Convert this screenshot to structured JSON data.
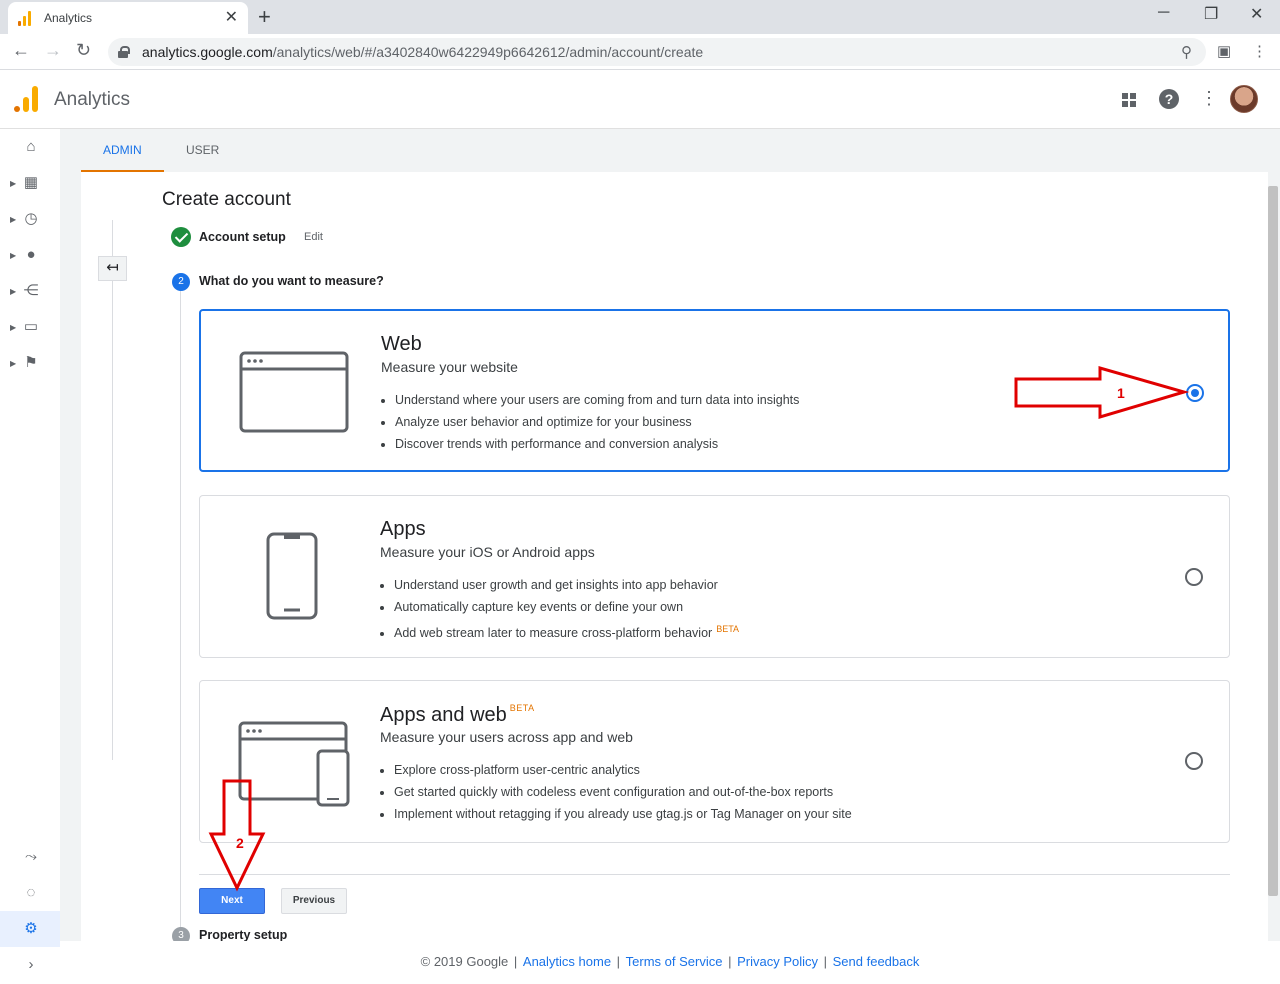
{
  "browser": {
    "tab_title": "Analytics",
    "tab_close": "✕",
    "new_tab": "+",
    "url_host": "analytics.google.com",
    "url_path": "/analytics/web/#/a3402840w6422949p6642612/admin/account/create",
    "controls": {
      "minimize": "─",
      "restore": "❐",
      "close": "✕"
    }
  },
  "header": {
    "app_name": "Analytics",
    "icons": [
      "apps-grid-icon",
      "help-icon",
      "more-vert-icon",
      "account-avatar"
    ]
  },
  "leftnav": {
    "items": [
      "home-icon",
      "customization-icon",
      "realtime-icon",
      "audience-icon",
      "acquisition-icon",
      "behavior-icon",
      "conversions-icon"
    ],
    "bottom_items": [
      "attribution-icon",
      "discover-icon",
      "admin-gear-icon",
      "expand-icon"
    ]
  },
  "subtabs": [
    {
      "label": "ADMIN",
      "active": true
    },
    {
      "label": "USER",
      "active": false
    }
  ],
  "page": {
    "title": "Create account",
    "back_glyph": "↤"
  },
  "steps": {
    "done": {
      "label": "Account setup",
      "edit": "Edit"
    },
    "current": {
      "num": "2",
      "label": "What do you want to measure?"
    },
    "next": {
      "num": "3",
      "label": "Property setup"
    }
  },
  "options": [
    {
      "title": "Web",
      "beta": "",
      "subtitle": "Measure your website",
      "bullets": [
        "Understand where your users are coming from and turn data into insights",
        "Analyze user behavior and optimize for your business",
        "Discover trends with performance and conversion analysis"
      ],
      "selected": true
    },
    {
      "title": "Apps",
      "beta": "",
      "subtitle": "Measure your iOS or Android apps",
      "bullets": [
        "Understand user growth and get insights into app behavior",
        "Automatically capture key events or define your own",
        "Add web stream later to measure cross-platform behavior"
      ],
      "bullet_beta": "BETA",
      "selected": false
    },
    {
      "title": "Apps and web",
      "beta": "BETA",
      "subtitle": "Measure your users across app and web",
      "bullets": [
        "Explore cross-platform user-centric analytics",
        "Get started quickly with codeless event configuration and out-of-the-box reports",
        "Implement without retagging if you already use gtag.js or Tag Manager on your site"
      ],
      "selected": false
    }
  ],
  "buttons": {
    "next": "Next",
    "previous": "Previous"
  },
  "footer": {
    "copyright": "© 2019 Google",
    "links": [
      "Analytics home",
      "Terms of Service",
      "Privacy Policy",
      "Send feedback"
    ]
  },
  "annotations": {
    "arrow1_label": "1",
    "arrow2_label": "2",
    "color": "#e00000"
  },
  "colors": {
    "accent": "#1a73e8",
    "brand": "#f9ab00",
    "beta": "#e37400"
  }
}
